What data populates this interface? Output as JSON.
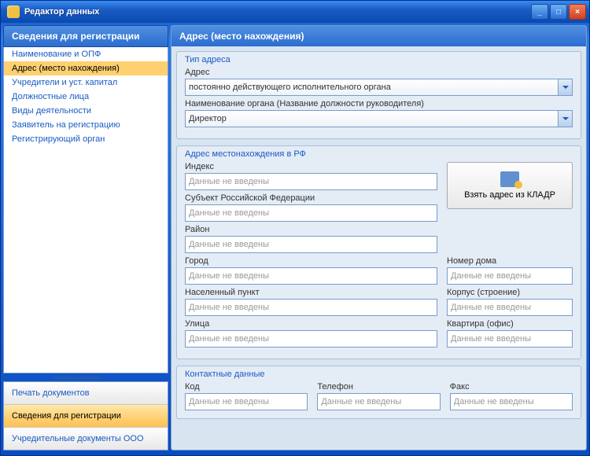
{
  "window": {
    "title": "Редактор данных"
  },
  "sidebar": {
    "header": "Сведения для регистрации",
    "items": [
      {
        "label": "Наименование и ОПФ"
      },
      {
        "label": "Адрес (место нахождения)"
      },
      {
        "label": "Учредители и уст. капитал"
      },
      {
        "label": "Должностные лица"
      },
      {
        "label": "Виды деятельности"
      },
      {
        "label": "Заявитель на регистрацию"
      },
      {
        "label": "Регистрирующий орган"
      }
    ],
    "selected_index": 1,
    "bottom": [
      {
        "label": "Печать документов"
      },
      {
        "label": "Сведения для регистрации"
      },
      {
        "label": "Учредительные документы ООО"
      }
    ],
    "bottom_active_index": 1
  },
  "main": {
    "header": "Адрес (место нахождения)",
    "group_type": {
      "title": "Тип адреса",
      "addr_label": "Адрес",
      "addr_value": "постоянно действующего исполнительного органа",
      "org_label": "Наименование органа (Название должности руководителя)",
      "org_value": "Директор"
    },
    "group_addr": {
      "title": "Адрес местонахождения в РФ",
      "placeholder": "Данные не введены",
      "index_label": "Индекс",
      "subject_label": "Субъект Российской Федерации",
      "district_label": "Район",
      "city_label": "Город",
      "locality_label": "Населенный пункт",
      "street_label": "Улица",
      "house_label": "Номер дома",
      "corpus_label": "Корпус (строение)",
      "flat_label": "Квартира (офис)",
      "kladr_button": "Взять адрес из КЛАДР"
    },
    "group_contact": {
      "title": "Контактные данные",
      "code_label": "Код",
      "phone_label": "Телефон",
      "fax_label": "Факс",
      "placeholder": "Данные не введены"
    }
  }
}
